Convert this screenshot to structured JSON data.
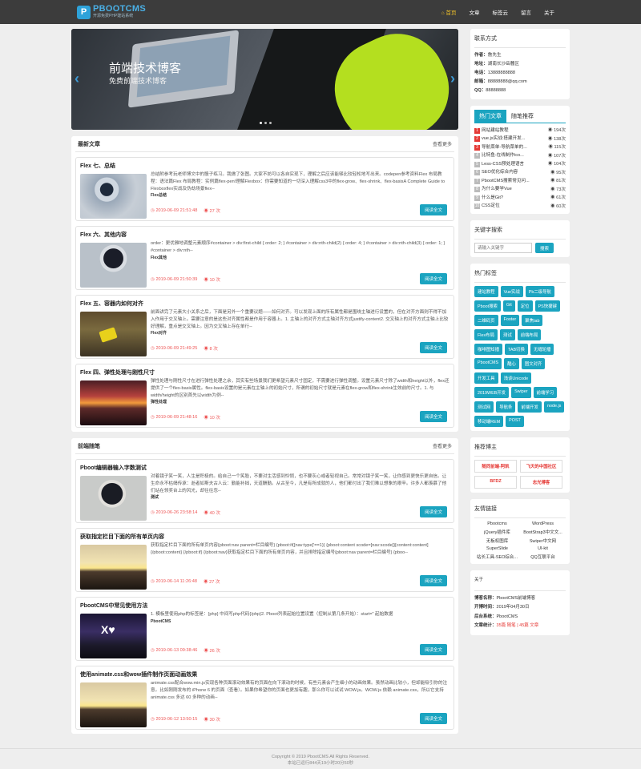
{
  "nav": {
    "logo_title": "PBOOTCMS",
    "logo_sub": "开源免费PHP建站系统",
    "items": [
      "首页",
      "文章",
      "标签云",
      "留言",
      "关于"
    ]
  },
  "slider": {
    "title": "前端技术博客",
    "subtitle": "免费前端技术博客"
  },
  "latest": {
    "title": "最新文章",
    "more": "查看更多",
    "read": "阅读全文",
    "items": [
      {
        "title": "Flex 七、总结",
        "body": "总结附参考玩老师博文中的骰子练习。我做了张图。大家不妨可以各自实现下，理解之后应该能够比较轻松地写出来。codepen参考资料Flex 布局教程：语法篇Flex 布局教程：实例篇flex-pen!理解Flexbox：你需要知道的一切深入理解css3中的flex-grow、flex-shrink、flex-basisA Complete Guide to Flexboxflex实战及伪劫场景flex--",
        "tag": "Flex总结",
        "date": "2019-06-09 21:51:48",
        "views": "27 次"
      },
      {
        "title": "Flex 六、其他内容",
        "body": "order：更优雅地调整元素顺序#container > div:first-child {  order: 2; } #container > div:nth-child(2) {  order: 4; } #container > div:nth-child(3) {  order: 1; } #container > div:nth--",
        "tag": "Flex其他",
        "date": "2019-06-09 21:50:39",
        "views": "10 次"
      },
      {
        "title": "Flex 五、容器内如何对齐",
        "body": "前面讲完了元素大小关系之后，下面是另外一个重要议题——如何对齐。可以发现上面的所有属性都是围绕主轴进行设置的，但在对齐方面则不得不加入作用于交叉轴上。需要注意的是这些对齐属性都是作用于容器上。1. 主轴上的对齐方式主轴对齐方式justify-content2. 交叉轴上的对齐方式主轴上比较好理解，重点是交叉轴上。因为交叉轴上存在单行--",
        "tag": "Flex对齐",
        "date": "2019-06-09 21:49:25",
        "views": "8 次"
      },
      {
        "title": "Flex 四、弹性处理与刚性尺寸",
        "body": "弹性处理与刚性尺寸在进行弹性处理之余，其实有些场景我们更希望元素尺寸固定，不需要进行弹性调整。设置元素尺寸除了width和height以外，flex还提供了一个flex-basis属性。flex-basis设置的是元素在主轴上的初始尺寸，所谓的初始尺寸就是元素在flex-grow和flex-shrink生效前的尺寸。1. 与width/height的区别首先以width为例--",
        "tag": "弹性处理",
        "date": "2019-06-09 21:48:16",
        "views": "10 次"
      }
    ]
  },
  "essays": {
    "title": "前端随笔",
    "more": "查看更多",
    "read": "阅读全文",
    "items": [
      {
        "title": "Pboot编辑器输入字数测试",
        "body": "对着镜子笑一笑，人生是积极的。给自己一个笑脸，不要对生活感到怜悯，也不要灰心或者轻视自己。常常对镜子笑一笑，让你感到更快乐更自信。让生命永不枯竭传承：逝者如斯夫古人云：勤能补拙，天道酬勤。从古至今，凡是有所成就的人，他们都付出了我们难以想象的艰辛。许多人都羡慕了他们站在领奖台上的风光，却往往忽--",
        "tag": "测试",
        "date": "2019-06-26 23:58:14",
        "views": "40 次"
      },
      {
        "title": "获取指定栏目下面的所有单页内容",
        "body": "获取指定栏目下面的所有单页内容{pboot:nav parent=栏目编号} {pboot:if([nav:type]'==1)} {pboot:content scode=[nav:scode]}[content:content] {/pboot:content} {/pboot:if} {/pboot:nav}获取指定栏目下面的所有单页内容，并且排除指定编号{pboot:nav parent=栏目编号} {pboo--",
        "tag": "",
        "date": "2019-06-14 11:26:48",
        "views": "27 次"
      },
      {
        "title": "PbootCMS中常见使用方法",
        "body": "1. 模板里使用php的标签是：{php}    中间写php代码{/php}2. Pboot列表起始位置设置（控制从第几条开始）：start=\" 起始数据",
        "tag": "PbootCMS",
        "date": "2019-06-13 09:38:46",
        "views": "26 次"
      },
      {
        "title": "使用animate.css和wow插件制作页面动画效果",
        "body": "animate.css配合wow.min.js实现各种页面滚动效果有的页面在向下滚动的时候，有些元素会产生细小的动画效果。虽然动画比较小，但却能吸引你的注意。比如刚刚发布的 iPhone 6 的页面（查看）。如果你希望你的页面也更加有趣，那么你可以试试 WOW.js。WOW.js 依赖 animate.css，所以它支持 animate.css 多达 60 多种的动画--",
        "tag": "",
        "date": "2019-06-12 13:50:15",
        "views": "30 次"
      }
    ]
  },
  "contact": {
    "title": "联系方式",
    "rows": [
      {
        "k": "作者：",
        "v": "詹先生"
      },
      {
        "k": "地址：",
        "v": "湖南长沙岳麓区"
      },
      {
        "k": "电话：",
        "v": "13888888888"
      },
      {
        "k": "邮箱：",
        "v": "88888888@qq.com"
      },
      {
        "k": "QQ：",
        "v": "88888888"
      }
    ]
  },
  "hot": {
    "tab1": "热门文章",
    "tab2": "随笔推荐",
    "items": [
      {
        "n": "1",
        "t": "网站建站教程",
        "v": "194次"
      },
      {
        "n": "2",
        "t": "vue.js实战:搭建开发...",
        "v": "138次"
      },
      {
        "n": "3",
        "t": "导航菜单-导航菜单的...",
        "v": "115次"
      },
      {
        "n": "4",
        "t": "比特鱼-在线制作ico...",
        "v": "107次"
      },
      {
        "n": "5",
        "t": "Less-CSS预处理语言",
        "v": "104次"
      },
      {
        "n": "6",
        "t": "SEO优化综合内容",
        "v": "95次"
      },
      {
        "n": "7",
        "t": "PbootCMS搜索常见问...",
        "v": "81次"
      },
      {
        "n": "8",
        "t": "为什么要学Vue",
        "v": "73次"
      },
      {
        "n": "9",
        "t": "什么是Git?",
        "v": "61次"
      },
      {
        "n": "10",
        "t": "CSS定位",
        "v": "60次"
      }
    ]
  },
  "search": {
    "title": "关键字搜索",
    "placeholder": "请输入关键字",
    "button": "搜索"
  },
  "tags": {
    "title": "热门标签",
    "items": [
      "建站教程",
      "Vue实战",
      "Pb二级导航",
      "Pboot搜索",
      "Git",
      "定位",
      "PS快捷键",
      "二维码页",
      "Footer",
      "聚焦tab",
      "Flex布局",
      "测试",
      "前端布局",
      "咖啡图知播",
      "TAB切换",
      "无缝轮播",
      "PbootCMS",
      "酷心",
      "图文对齐",
      "开发工具",
      "浅谈Unicode",
      "2019WEB开发",
      "Swiper",
      "前端学习",
      "测试网",
      "导航条",
      "前端开发",
      "node.js",
      "移动端REM",
      "POST"
    ]
  },
  "blogger": {
    "title": "推荐博主",
    "items": [
      "随同前端-阿凯",
      "飞天的中国社区",
      "BFDZ",
      "志光博客"
    ]
  },
  "links": {
    "title": "友情链接",
    "items": [
      "Pbootcms",
      "WordPress",
      "jQuery插件库",
      "BootStrap3中文文...",
      "无板权图库",
      "Swiper中文网",
      "SuperSlide",
      "UI-kit",
      "站长工具-SEO综合...",
      "QQ互联平台"
    ]
  },
  "about": {
    "title": "关于",
    "rows": [
      {
        "k": "博客名称：",
        "v": "PbootCMS前端博客"
      },
      {
        "k": "开博时间：",
        "v": "2019年04月30日"
      },
      {
        "k": "后台系统：",
        "v": "PbootCMS"
      },
      {
        "k": "文章统计：",
        "v": "35篇 随笔 | 45篇 文章"
      }
    ]
  },
  "footer": {
    "line1": "Copyright © 2019 PbootCMS All Rights Reserved.",
    "line2": "本站已运行844天19小时20分50秒"
  }
}
